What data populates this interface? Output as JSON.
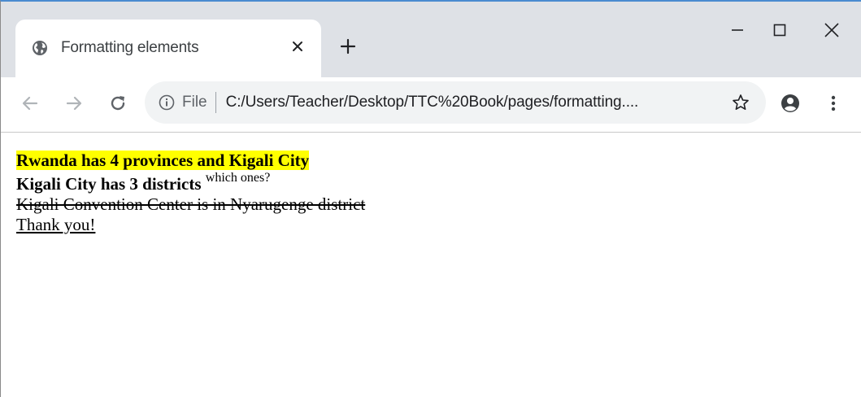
{
  "browser": {
    "tab": {
      "title": "Formatting elements",
      "favicon": "globe-icon",
      "close_icon": "close-icon"
    },
    "new_tab_icon": "plus-icon",
    "window_controls": [
      "minimize-icon",
      "maximize-icon",
      "close-icon"
    ],
    "nav": [
      "back-arrow-icon",
      "forward-arrow-icon",
      "reload-icon"
    ],
    "omnibox": {
      "scheme_label": "File",
      "url": "C:/Users/Teacher/Desktop/TTC%20Book/pages/formatting...."
    },
    "toolbar_icons": [
      "star-icon",
      "profile-icon",
      "menu-icon"
    ]
  },
  "page": {
    "line1": "Rwanda has 4 provinces and Kigali City",
    "line2_main": "Kigali City has 3 districts",
    "line2_sup": "which ones?",
    "line3": "Kigali Convention Center is in Nyarugenge district",
    "line4": "Thank you!"
  },
  "colors": {
    "highlight": "#ffff00",
    "tabstrip": "#dee1e6",
    "omnibox": "#f1f3f4",
    "window_border": "#4a8bd0"
  }
}
